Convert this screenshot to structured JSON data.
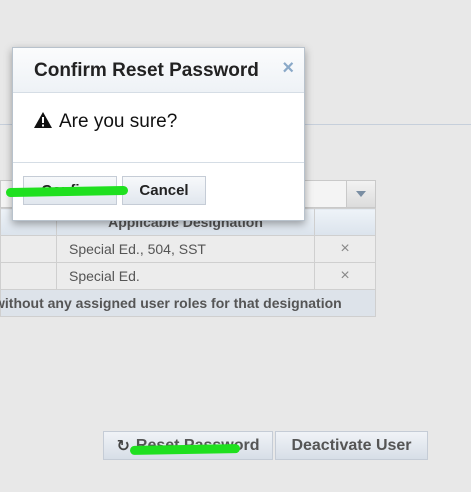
{
  "modal": {
    "title": "Confirm Reset Password",
    "close_symbol": "×",
    "warning_icon": "warning-icon",
    "message": "Are you sure?",
    "confirm_label": "Confirm",
    "cancel_label": "Cancel"
  },
  "table": {
    "header": "Applicable Designation",
    "rows": [
      {
        "designation": "Special Ed., 504, SST",
        "remove": "×"
      },
      {
        "designation": "Special Ed.",
        "remove": "×"
      }
    ],
    "footer_text": "without any assigned user roles for that designation"
  },
  "actions": {
    "reset_icon": "↻",
    "reset_label": "Reset Password",
    "deactivate_label": "Deactivate User"
  },
  "colors": {
    "highlight": "#1fe01f",
    "modal_close": "#8aa9c8"
  }
}
